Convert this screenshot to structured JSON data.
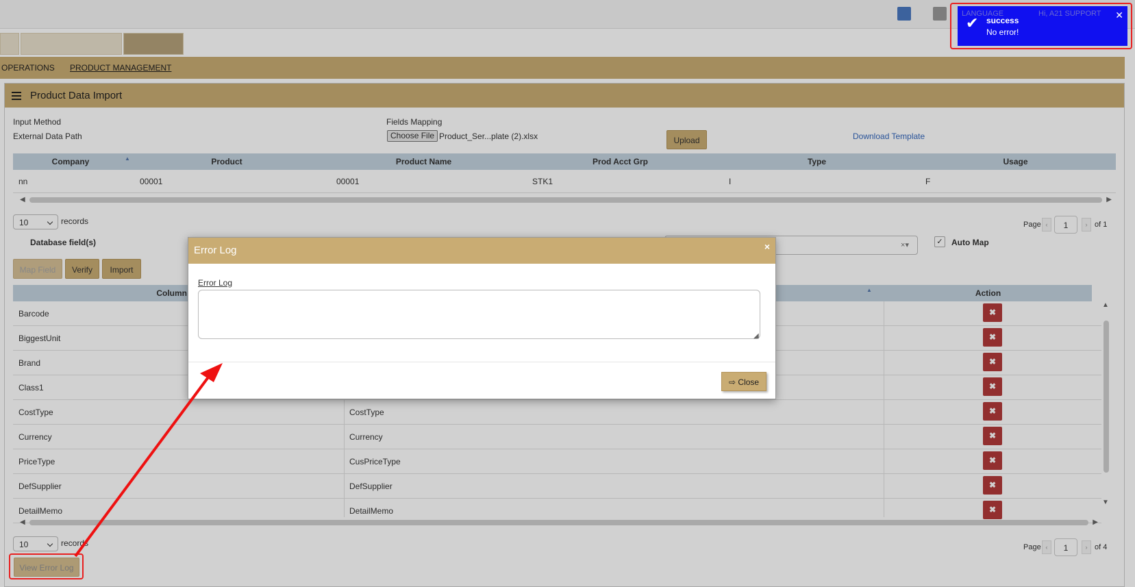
{
  "header": {
    "language_label": "LANGUAGE",
    "user_greeting": "Hi, A21 SUPPORT"
  },
  "nav": {
    "items": [
      {
        "label": "OPERATIONS"
      },
      {
        "label": "PRODUCT MANAGEMENT"
      }
    ]
  },
  "panel": {
    "title": "Product Data Import",
    "input_method_label": "Input Method",
    "external_path_label": "External Data Path",
    "fields_mapping_label": "Fields Mapping",
    "choose_file_label": "Choose File",
    "file_name": "Product_Ser...plate (2).xlsx",
    "upload_label": "Upload",
    "download_template_label": "Download Template"
  },
  "preview_grid": {
    "columns": [
      "Company",
      "Product",
      "Product Name",
      "Prod Acct Grp",
      "Type",
      "Usage"
    ],
    "rows": [
      [
        "nn",
        "00001",
        "00001",
        "STK1",
        "I",
        "F"
      ]
    ]
  },
  "pager_top": {
    "page_size": "10",
    "records_label": "records",
    "page_label": "Page",
    "page_value": "1",
    "of_label": "of 1"
  },
  "mapping": {
    "database_fields_label": "Database field(s)",
    "auto_map_label": "Auto Map",
    "map_field_label": "Map Field",
    "verify_label": "Verify",
    "import_label": "Import"
  },
  "mapping_grid": {
    "columns": [
      "Column Na",
      "Action"
    ],
    "rows": [
      {
        "column": "Barcode",
        "field": ""
      },
      {
        "column": "BiggestUnit",
        "field": ""
      },
      {
        "column": "Brand",
        "field": ""
      },
      {
        "column": "Class1",
        "field": ""
      },
      {
        "column": "CostType",
        "field": "CostType"
      },
      {
        "column": "Currency",
        "field": "Currency"
      },
      {
        "column": "PriceType",
        "field": "CusPriceType"
      },
      {
        "column": "DefSupplier",
        "field": "DefSupplier"
      },
      {
        "column": "DetailMemo",
        "field": "DetailMemo"
      }
    ],
    "action_glyph": "✖"
  },
  "pager_bottom": {
    "page_size": "10",
    "records_label": "records",
    "page_label": "Page",
    "page_value": "1",
    "of_label": "of 4"
  },
  "view_error_log_label": "View Error Log",
  "modal": {
    "title": "Error Log",
    "close_x": "×",
    "field_label": "Error Log",
    "textarea_value": "",
    "close_button_label": "Close"
  },
  "toast": {
    "title": "success",
    "message": "No error!",
    "close": "✕"
  },
  "colors": {
    "gold": "#c9ac73",
    "toast_blue": "#1010f0",
    "highlight_red": "#e82020",
    "delete_red": "#b23a3a"
  }
}
